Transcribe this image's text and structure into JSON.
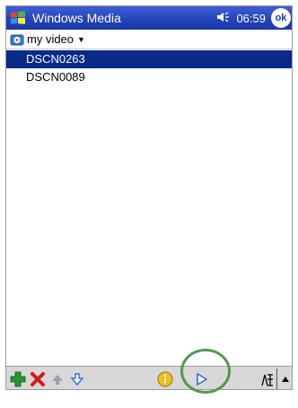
{
  "titlebar": {
    "app_title": "Windows Media",
    "clock": "06:59",
    "ok_label": "ok"
  },
  "folder": {
    "label": "my video"
  },
  "list": {
    "items": [
      "DSCN0263",
      "DSCN0089"
    ],
    "selected_index": 0
  },
  "colors": {
    "titlebar": "#2242b8",
    "selection": "#0a2a8a",
    "toolbar": "#d8d8d8",
    "highlight_ring": "#4f9a4f"
  },
  "toolbar": {
    "icons": [
      "add-icon",
      "delete-icon",
      "move-up-icon",
      "move-down-icon",
      "info-icon",
      "play-icon",
      "input-panel-icon",
      "input-panel-arrow-icon"
    ]
  }
}
